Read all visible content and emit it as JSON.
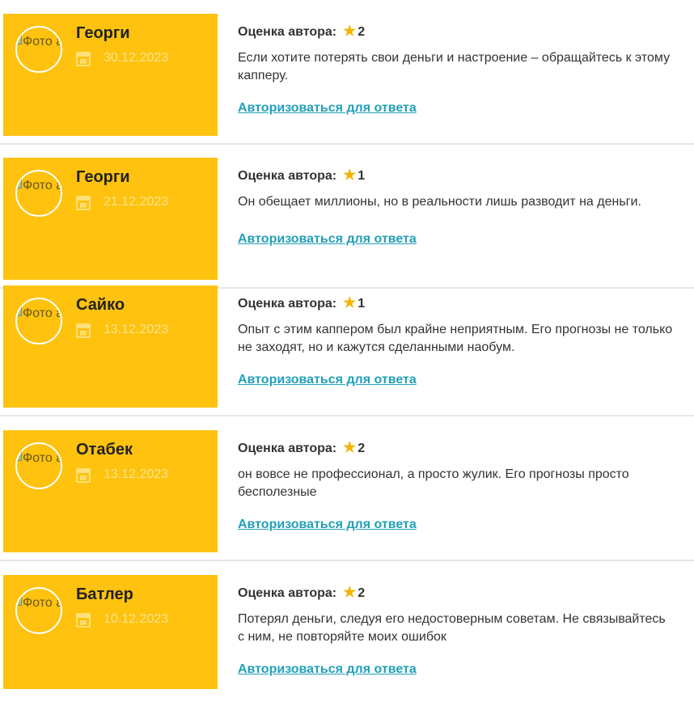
{
  "avatar_alt": "Фото аватар",
  "rating_label": "Оценка автора:",
  "reply_link": "Авторизоваться для ответа",
  "colors": {
    "side_bg": "#fec20f",
    "link": "#22a0b8",
    "star": "#f4b400"
  },
  "reviews": [
    {
      "name": "Георги",
      "date": "30.12.2023",
      "rating": "2",
      "text": "Если хотите потерять свои деньги и настроение – обращайтесь к этому капперу."
    },
    {
      "name": "Георги",
      "date": "21.12.2023",
      "rating": "1",
      "text": "Он обещает миллионы, но в реальности лишь разводит на деньги."
    },
    {
      "name": "Сайко",
      "date": "13.12.2023",
      "rating": "1",
      "text": "Опыт с этим каппером был крайне неприятным. Его прогнозы не только не заходят, но и кажутся сделанными наобум."
    },
    {
      "name": "Отабек",
      "date": "13.12.2023",
      "rating": "2",
      "text": "он вовсе не профессионал, а просто жулик. Его прогнозы просто бесполезные"
    },
    {
      "name": "Батлер",
      "date": "10.12.2023",
      "rating": "2",
      "text": "Потерял деньги, следуя его недостоверным советам. Не связывайтесь с ним, не повторяйте моих ошибок"
    }
  ]
}
